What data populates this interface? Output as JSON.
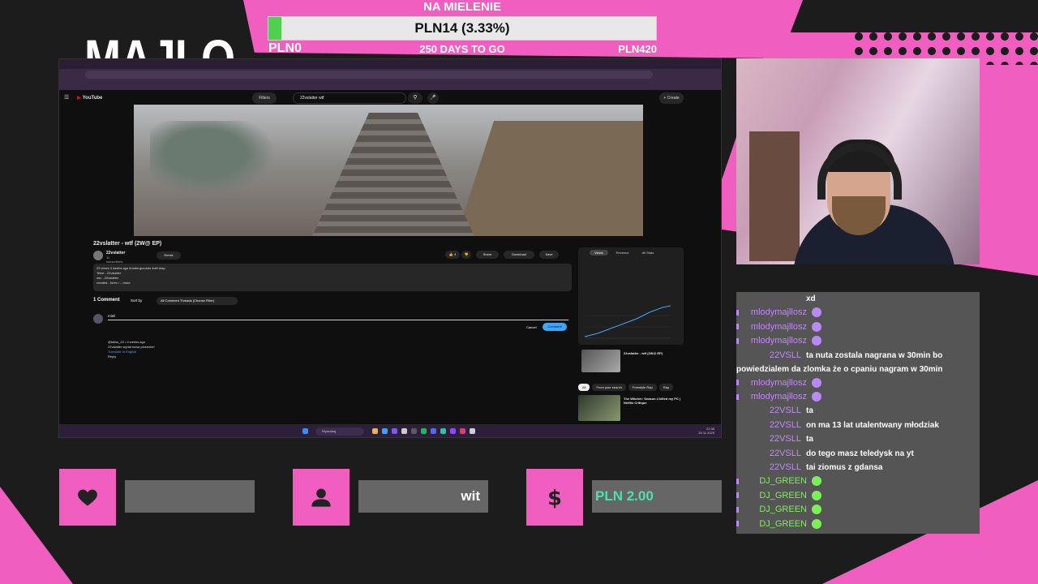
{
  "overlay": {
    "brand": "MAJLO",
    "goal": {
      "title": "NA MIELENIE",
      "current": "PLN14 (3.33%)",
      "progress_fraction": 0.0333,
      "start": "PLN0",
      "days_left": "250 DAYS TO GO",
      "target": "PLN420"
    },
    "bottom": {
      "follower": "",
      "subscriber": "wit",
      "donation": "PLN 2.00"
    },
    "colors": {
      "accent": "#f05fc0",
      "goal_fill": "#4fd04f",
      "donation_text": "#4fe0b0"
    }
  },
  "screen": {
    "youtube": {
      "logo": "YouTube",
      "filters": "Filters",
      "search_query": "22vslatter wtf",
      "create": "+ Create",
      "video_title": "22vslatter - wtf (2W@ EP)",
      "channel": "22vslatter",
      "subscribers": "11 subscribers",
      "join": "Remix",
      "actions": {
        "like": "4",
        "share": "Share",
        "download": "Download",
        "save": "Save"
      },
      "description": [
        "29 views 4 weeks ago #undergrounds #wtf #rap",
        "Tekst - 22vslatter",
        "mix - 22vslatter",
        "created - forex / ...more"
      ],
      "comments_count": "1 Comment",
      "sort_by": "Sort by",
      "thread_filter": "All Comment Threads (Choose Filter)",
      "comment_draft": "mieli",
      "cancel": "Cancel",
      "comment_button": "Comment",
      "reply": {
        "author": "@taliss_22 • 4 weeks ago",
        "text": "22vslatter wydał nowa piosenke!",
        "translate": "Translate to English",
        "reply_label": "Reply"
      },
      "side_tabs": [
        "Views",
        "Revenue",
        "All Stats"
      ],
      "side_video_title": "22vslatter - wtf (2W@ EP)",
      "chips": [
        "All",
        "From your search",
        "Freestyle Rap",
        "Rap"
      ],
      "rec_title": "The Witcher: Season 4 killed my PC | Netflix Critique"
    },
    "taskbar": {
      "search": "Wyszukaj",
      "time": "22:35",
      "date": "25.11.2025"
    }
  },
  "chat": {
    "rows": [
      {
        "user": "",
        "msg": "xd",
        "color": "#ffffff"
      },
      {
        "user": "mlodymajllosz",
        "msg": "",
        "color": "#c08af5",
        "badge": true
      },
      {
        "user": "mlodymajllosz",
        "msg": "",
        "color": "#c08af5",
        "badge": true
      },
      {
        "user": "mlodymajllosz",
        "msg": "",
        "color": "#c08af5",
        "badge": true
      },
      {
        "user": "22VSLL",
        "msg": "ta nuta zostala nagrana w 30min bo powiedzialem da zlomka że o cpaniu nagram w 30min",
        "color": "#c08af5",
        "wrap": true
      },
      {
        "user": "mlodymajllosz",
        "msg": "",
        "color": "#c08af5",
        "badge": true
      },
      {
        "user": "mlodymajllosz",
        "msg": "",
        "color": "#c08af5",
        "badge": true
      },
      {
        "user": "22VSLL",
        "msg": "ta",
        "color": "#c08af5"
      },
      {
        "user": "22VSLL",
        "msg": "on ma 13 lat utalentwany młodziak",
        "color": "#c08af5"
      },
      {
        "user": "22VSLL",
        "msg": "ta",
        "color": "#c08af5"
      },
      {
        "user": "22VSLL",
        "msg": "do tego masz teledysk na yt",
        "color": "#c08af5"
      },
      {
        "user": "22VSLL",
        "msg": "tai ziomus z gdansa",
        "color": "#c08af5"
      },
      {
        "user": "DJ_GREEN",
        "msg": "",
        "color": "#7cf05a",
        "badge": true
      },
      {
        "user": "DJ_GREEN",
        "msg": "",
        "color": "#7cf05a",
        "badge": true
      },
      {
        "user": "DJ_GREEN",
        "msg": "",
        "color": "#7cf05a",
        "badge": true
      },
      {
        "user": "DJ_GREEN",
        "msg": "",
        "color": "#7cf05a",
        "badge": true
      }
    ]
  }
}
